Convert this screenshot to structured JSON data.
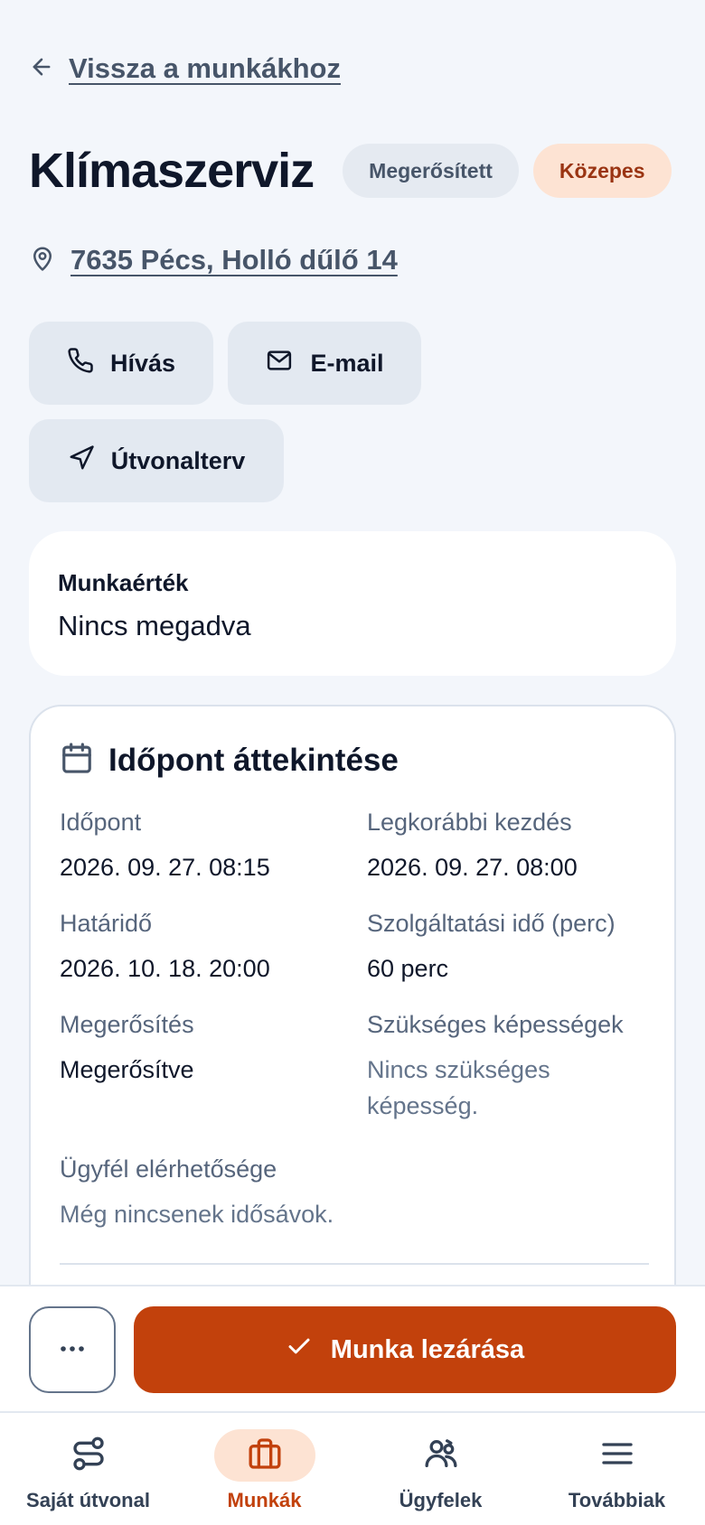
{
  "header": {
    "back_label": "Vissza a munkákhoz",
    "title": "Klímaszerviz",
    "status_badge": "Megerősített",
    "priority_badge": "Közepes",
    "address": "7635 Pécs, Holló dűlő 14"
  },
  "actions": {
    "call_label": "Hívás",
    "email_label": "E-mail",
    "route_label": "Útvonalterv"
  },
  "value_card": {
    "label": "Munkaérték",
    "value": "Nincs megadva"
  },
  "schedule": {
    "title": "Időpont áttekintése",
    "fields": [
      {
        "label": "Időpont",
        "value": "2026. 09. 27. 08:15"
      },
      {
        "label": "Legkorábbi kezdés",
        "value": "2026. 09. 27. 08:00"
      },
      {
        "label": "Határidő",
        "value": "2026. 10. 18. 20:00"
      },
      {
        "label": "Szolgáltatási idő (perc)",
        "value": "60 perc"
      },
      {
        "label": "Megerősítés",
        "value": "Megerősítve"
      },
      {
        "label": "Szükséges képességek",
        "value": "Nincs szükséges képesség."
      },
      {
        "label": "Ügyfél elérhetősége",
        "value": "Még nincsenek idősávok."
      }
    ]
  },
  "bottom_actions": {
    "more_label": "...",
    "primary_label": "Munka lezárása"
  },
  "nav": {
    "items": [
      {
        "label": "Saját útvonal",
        "icon": "route-icon"
      },
      {
        "label": "Munkák",
        "icon": "briefcase-icon",
        "active": true
      },
      {
        "label": "Ügyfelek",
        "icon": "users-icon"
      },
      {
        "label": "Továbbiak",
        "icon": "menu-icon"
      }
    ]
  },
  "colors": {
    "accent": "#c2410c",
    "accent_soft": "#fde3d3",
    "background": "#f3f6fb",
    "muted_text": "#64748b"
  }
}
